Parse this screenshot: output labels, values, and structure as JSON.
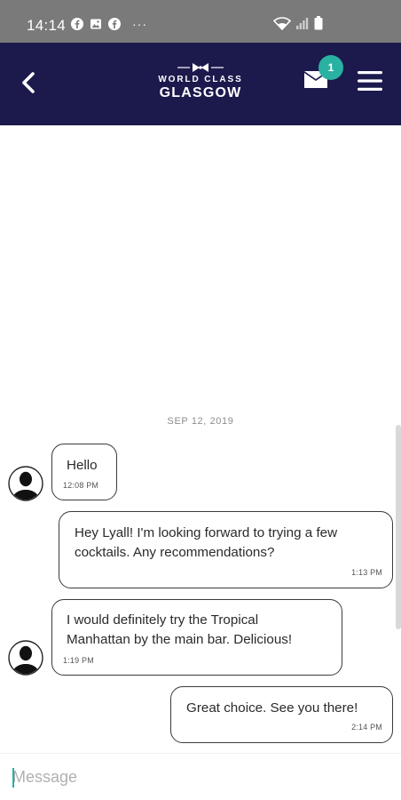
{
  "status_bar": {
    "time": "14:14",
    "more": "···"
  },
  "header": {
    "logo_line1": "WORLD CLASS",
    "logo_line2": "GLASGOW",
    "unread_count": "1"
  },
  "chat": {
    "date": "SEP 12, 2019",
    "messages": [
      {
        "from": "them",
        "text": "Hello",
        "time": "12:08 PM"
      },
      {
        "from": "me",
        "text_lines": [
          "Hey Lyall! I'm looking forward to trying a few",
          "cocktails. Any recommendations?"
        ],
        "time": "1:13 PM"
      },
      {
        "from": "them",
        "text_lines": [
          "I would definitely try the Tropical",
          "Manhattan by the main bar. Delicious!"
        ],
        "time": "1:19 PM"
      },
      {
        "from": "me",
        "text": "Great choice. See you there!",
        "time": "2:14 PM"
      }
    ]
  },
  "composer": {
    "placeholder": "Message"
  },
  "colors": {
    "header_bg": "#1c1a4c",
    "badge": "#29b1a1",
    "status_bar": "#7a7a7a"
  }
}
